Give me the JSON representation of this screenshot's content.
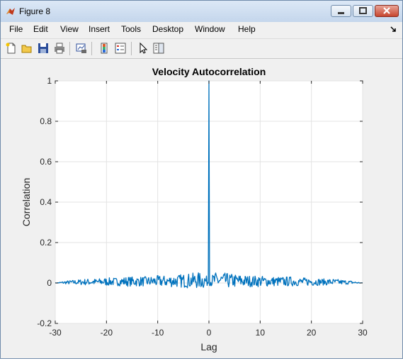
{
  "window": {
    "title": "Figure 8"
  },
  "menu": [
    "File",
    "Edit",
    "View",
    "Insert",
    "Tools",
    "Desktop",
    "Window",
    "Help"
  ],
  "toolbar_icons": [
    "new-figure-icon",
    "open-file-icon",
    "save-icon",
    "print-icon",
    "link-plot-icon",
    "insert-colorbar-icon",
    "insert-legend-icon",
    "edit-plot-icon",
    "property-inspector-icon"
  ],
  "chart_data": {
    "type": "line",
    "title": "Velocity Autocorrelation",
    "xlabel": "Lag",
    "ylabel": "Correlation",
    "xlim": [
      -30,
      30
    ],
    "ylim": [
      -0.2,
      1
    ],
    "xticks": [
      -30,
      -20,
      -10,
      0,
      10,
      20,
      30
    ],
    "yticks": [
      -0.2,
      0,
      0.2,
      0.4,
      0.6,
      0.8,
      1
    ],
    "grid": true,
    "color": "#0072bd",
    "series": [
      {
        "x": [
          -30,
          -28,
          -26,
          -24,
          -22,
          -20,
          -18,
          -16,
          -14,
          -12,
          -10,
          -8,
          -6,
          -4,
          -2,
          -1,
          -0.1,
          0,
          0.1,
          1,
          2,
          4,
          6,
          8,
          10,
          12,
          14,
          16,
          18,
          20,
          22,
          24,
          26,
          28,
          30
        ],
        "y": [
          0,
          0.01,
          0.015,
          0.02,
          0.02,
          0.025,
          0.025,
          0.03,
          0.03,
          0.03,
          0.035,
          0.035,
          0.04,
          0.045,
          0.05,
          0.05,
          0.02,
          1,
          0.02,
          0.05,
          0.05,
          0.045,
          0.04,
          0.035,
          0.035,
          0.03,
          0.03,
          0.03,
          0.025,
          0.025,
          0.02,
          0.02,
          0.015,
          0.01,
          0
        ]
      }
    ]
  }
}
